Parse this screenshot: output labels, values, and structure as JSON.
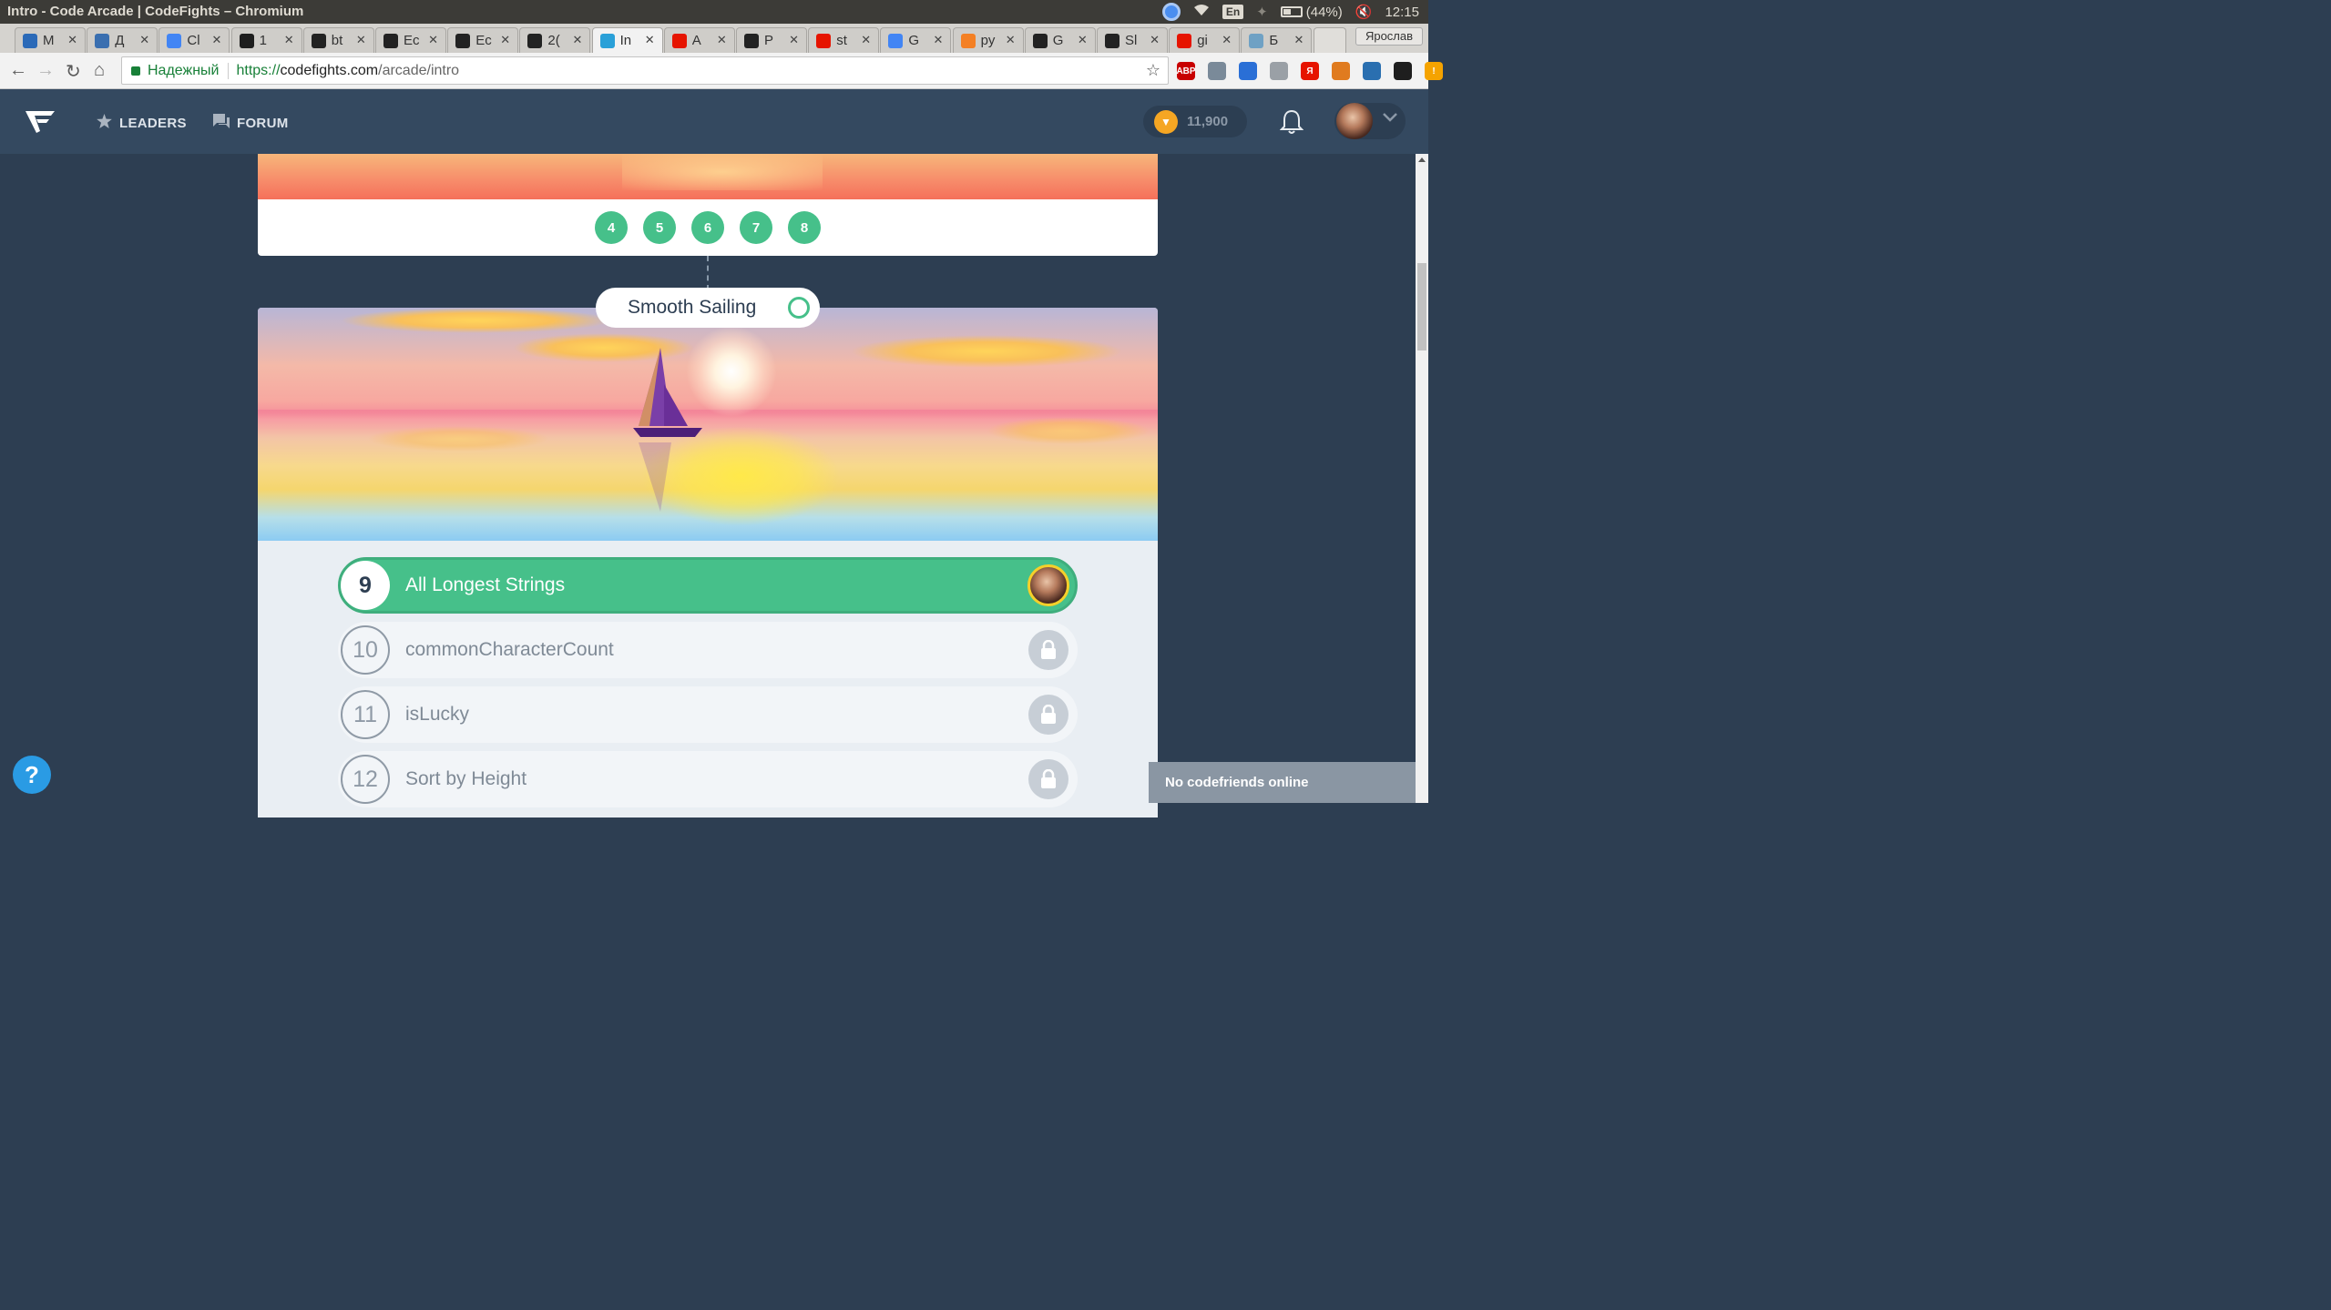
{
  "os": {
    "window_title": "Intro - Code Arcade | CodeFights – Chromium",
    "lang": "En",
    "battery": "(44%)",
    "clock": "12:15"
  },
  "tabs": [
    {
      "label": "M",
      "icon": "trello-icon",
      "color": "#2b6ab8"
    },
    {
      "label": "Д",
      "icon": "chat-icon",
      "color": "#3a6fb0"
    },
    {
      "label": "Cl",
      "icon": "docs-icon",
      "color": "#4285f4"
    },
    {
      "label": "1",
      "icon": "equalizer-icon",
      "color": "#1e1e1e"
    },
    {
      "label": "bt",
      "icon": "github-icon",
      "color": "#222"
    },
    {
      "label": "Ec",
      "icon": "github-icon",
      "color": "#222"
    },
    {
      "label": "Ec",
      "icon": "github-icon",
      "color": "#222"
    },
    {
      "label": "2(",
      "icon": "github-icon",
      "color": "#222"
    },
    {
      "label": "In",
      "icon": "codefights-icon",
      "color": "#2aa0d8",
      "active": true
    },
    {
      "label": "A",
      "icon": "yandex-icon",
      "color": "#e61400"
    },
    {
      "label": "P",
      "icon": "github-icon",
      "color": "#222"
    },
    {
      "label": "st",
      "icon": "yandex-icon",
      "color": "#e61400"
    },
    {
      "label": "G",
      "icon": "google-icon",
      "color": "#4285f4"
    },
    {
      "label": "py",
      "icon": "stackoverflow-icon",
      "color": "#f48024"
    },
    {
      "label": "G",
      "icon": "github-icon",
      "color": "#222"
    },
    {
      "label": "Sl",
      "icon": "github-icon",
      "color": "#222"
    },
    {
      "label": "gi",
      "icon": "yandex-icon",
      "color": "#e61400"
    },
    {
      "label": "Б",
      "icon": "habr-icon",
      "color": "#6fa1c4"
    }
  ],
  "profile_name": "Ярослав",
  "address": {
    "secure_label": "Надежный",
    "scheme": "https://",
    "host": "codefights.com",
    "path": "/arcade/intro"
  },
  "extensions": [
    {
      "name": "adblock-icon",
      "color": "#c80000",
      "text": "ABP"
    },
    {
      "name": "extension-icon",
      "color": "#7a8a99",
      "text": ""
    },
    {
      "name": "pipette-icon",
      "color": "#2a6fd6",
      "text": ""
    },
    {
      "name": "paw-icon",
      "color": "#9aa0a6",
      "text": ""
    },
    {
      "name": "yandex-icon",
      "color": "#e61400",
      "text": "Я"
    },
    {
      "name": "fox-icon",
      "color": "#e07b1f",
      "text": ""
    },
    {
      "name": "bluebox-icon",
      "color": "#2a6fb0",
      "text": ""
    },
    {
      "name": "react-icon",
      "color": "#1e1e1e",
      "text": ""
    },
    {
      "name": "warning-icon",
      "color": "#f5a300",
      "text": "!"
    }
  ],
  "header": {
    "leaders": "LEADERS",
    "forum": "FORUM",
    "coins": "11,900"
  },
  "previous_topic": {
    "levels": [
      "4",
      "5",
      "6",
      "7",
      "8"
    ]
  },
  "topic": {
    "title": "Smooth Sailing",
    "levels": [
      {
        "number": "9",
        "name": "All Longest Strings",
        "state": "current"
      },
      {
        "number": "10",
        "name": "commonCharacterCount",
        "state": "locked"
      },
      {
        "number": "11",
        "name": "isLucky",
        "state": "locked"
      },
      {
        "number": "12",
        "name": "Sort by Height",
        "state": "locked"
      }
    ]
  },
  "help_label": "?",
  "friends_status": "No codefriends online"
}
